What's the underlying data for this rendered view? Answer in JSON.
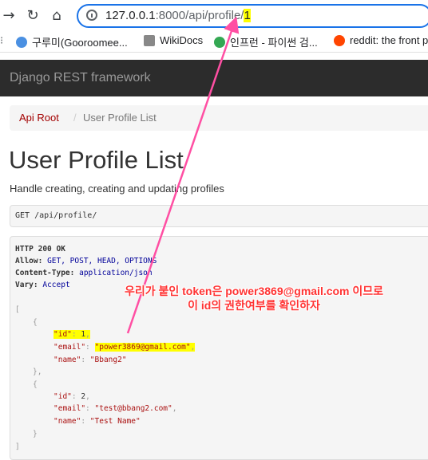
{
  "browser": {
    "url_main": "127.0.0.1",
    "url_dim": ":8000/api/profile/",
    "url_id": "1",
    "bookmarks": [
      {
        "label": "구루미(Gooroomee...",
        "color": "#4a90e2"
      },
      {
        "label": "WikiDocs",
        "color": "#888888"
      },
      {
        "label": "인프런 - 파이썬 검...",
        "color": "#34a853"
      },
      {
        "label": "reddit: the front p",
        "color": "#ff4500"
      }
    ]
  },
  "navbar": {
    "brand": "Django REST framework"
  },
  "breadcrumb": {
    "root": "Api Root",
    "sep": "/",
    "current": "User Profile List"
  },
  "page": {
    "title": "User Profile List",
    "description": "Handle creating, creating and updating profiles",
    "request": "GET /api/profile/"
  },
  "response": {
    "status": "HTTP 200 OK",
    "headers": [
      {
        "name": "Allow:",
        "value": "GET, POST, HEAD, OPTIONS"
      },
      {
        "name": "Content-Type:",
        "value": "application/json"
      },
      {
        "name": "Vary:",
        "value": "Accept"
      }
    ],
    "items": [
      {
        "id": "1",
        "email": "\"power3869@gmail.com\"",
        "name": "\"Bbang2\""
      },
      {
        "id": "2",
        "email": "\"test@bbang2.com\"",
        "name": "\"Test Name\""
      }
    ],
    "keys": {
      "id": "\"id\"",
      "email": "\"email\"",
      "name": "\"name\""
    }
  },
  "annotation": {
    "line1": "우리가 붙인 token은 power3869@gmail.com 이므로",
    "line2": "이 id의 권한여부를 확인하자",
    "color": "#ff3333"
  }
}
